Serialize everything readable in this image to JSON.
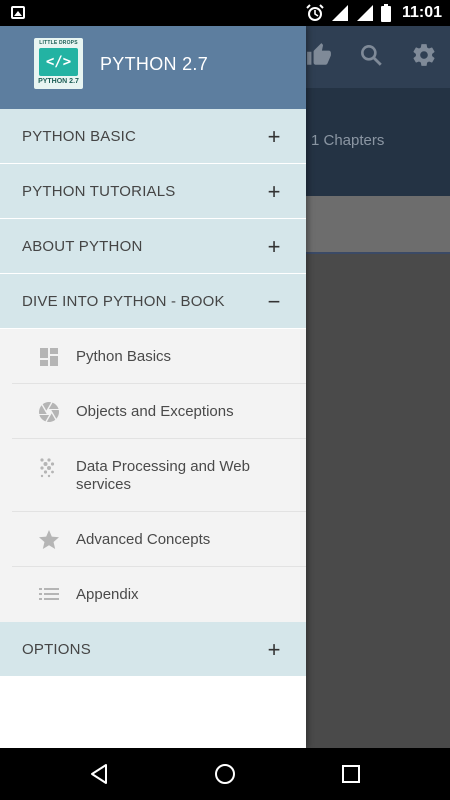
{
  "status_bar": {
    "time": "11:01",
    "icons": [
      "image-notification-icon",
      "alarm-icon",
      "wifi-icon",
      "signal-icon",
      "battery-icon"
    ]
  },
  "drawer": {
    "header": {
      "logo_top": "LITTLE DROPS",
      "logo_symbol": "</>",
      "logo_bottom": "PYTHON 2.7",
      "title": "PYTHON 2.7"
    },
    "sections": [
      {
        "label": "PYTHON BASIC",
        "toggle": "+"
      },
      {
        "label": "PYTHON TUTORIALS",
        "toggle": "+"
      },
      {
        "label": "ABOUT PYTHON",
        "toggle": "+"
      },
      {
        "label": "DIVE INTO PYTHON - BOOK",
        "toggle": "−"
      }
    ],
    "subitems": [
      {
        "label": "Python Basics",
        "icon": "dashboard-icon"
      },
      {
        "label": "Objects and Exceptions",
        "icon": "aperture-icon"
      },
      {
        "label": "Data Processing and Web services",
        "icon": "dots-grid-icon"
      },
      {
        "label": "Advanced Concepts",
        "icon": "star-icon"
      },
      {
        "label": "Appendix",
        "icon": "list-icon"
      }
    ],
    "options": {
      "label": "OPTIONS",
      "toggle": "+"
    }
  },
  "background": {
    "chapters_text": "1 Chapters",
    "toolbar_icons": [
      "thumbs-up-icon",
      "search-icon",
      "settings-icon"
    ]
  },
  "nav_bar": {
    "buttons": [
      "back-icon",
      "home-icon",
      "recents-icon"
    ]
  },
  "colors": {
    "drawer_header": "#5d7e9f",
    "section_bg": "#d5e6ea",
    "sublist_bg": "#f3f3f3",
    "bg_toolbar": "#2f3f53"
  }
}
